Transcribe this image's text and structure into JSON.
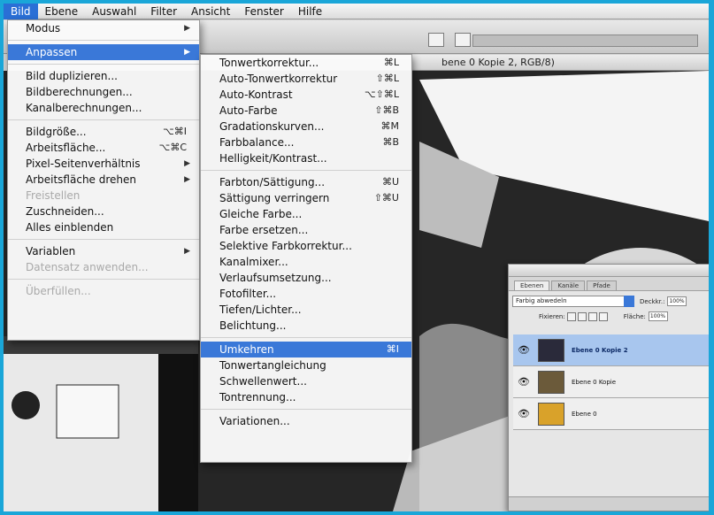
{
  "menubar": [
    "Bild",
    "Ebene",
    "Auswahl",
    "Filter",
    "Ansicht",
    "Fenster",
    "Hilfe"
  ],
  "doc_title": "bene 0 Kopie 2, RGB/8)",
  "bild_menu": [
    {
      "label": "Modus",
      "arrow": true
    },
    {
      "sep": true
    },
    {
      "label": "Anpassen",
      "arrow": true,
      "highlight": true
    },
    {
      "sep": true
    },
    {
      "label": "Bild duplizieren..."
    },
    {
      "label": "Bildberechnungen..."
    },
    {
      "label": "Kanalberechnungen..."
    },
    {
      "sep": true
    },
    {
      "label": "Bildgröße...",
      "shortcut": "⌥⌘I"
    },
    {
      "label": "Arbeitsfläche...",
      "shortcut": "⌥⌘C"
    },
    {
      "label": "Pixel-Seitenverhältnis",
      "arrow": true
    },
    {
      "label": "Arbeitsfläche drehen",
      "arrow": true
    },
    {
      "label": "Freistellen",
      "disabled": true
    },
    {
      "label": "Zuschneiden..."
    },
    {
      "label": "Alles einblenden"
    },
    {
      "sep": true
    },
    {
      "label": "Variablen",
      "arrow": true
    },
    {
      "label": "Datensatz anwenden...",
      "disabled": true
    },
    {
      "sep": true
    },
    {
      "label": "Überfüllen...",
      "disabled": true
    }
  ],
  "anpassen_menu": [
    {
      "label": "Tonwertkorrektur...",
      "shortcut": "⌘L"
    },
    {
      "label": "Auto-Tonwertkorrektur",
      "shortcut": "⇧⌘L"
    },
    {
      "label": "Auto-Kontrast",
      "shortcut": "⌥⇧⌘L"
    },
    {
      "label": "Auto-Farbe",
      "shortcut": "⇧⌘B"
    },
    {
      "label": "Gradationskurven...",
      "shortcut": "⌘M"
    },
    {
      "label": "Farbbalance...",
      "shortcut": "⌘B"
    },
    {
      "label": "Helligkeit/Kontrast..."
    },
    {
      "sep": true
    },
    {
      "label": "Farbton/Sättigung...",
      "shortcut": "⌘U"
    },
    {
      "label": "Sättigung verringern",
      "shortcut": "⇧⌘U"
    },
    {
      "label": "Gleiche Farbe..."
    },
    {
      "label": "Farbe ersetzen..."
    },
    {
      "label": "Selektive Farbkorrektur..."
    },
    {
      "label": "Kanalmixer..."
    },
    {
      "label": "Verlaufsumsetzung..."
    },
    {
      "label": "Fotofilter..."
    },
    {
      "label": "Tiefen/Lichter..."
    },
    {
      "label": "Belichtung..."
    },
    {
      "sep": true
    },
    {
      "label": "Umkehren",
      "shortcut": "⌘I",
      "highlight": true
    },
    {
      "label": "Tonwertangleichung"
    },
    {
      "label": "Schwellenwert..."
    },
    {
      "label": "Tontrennung..."
    },
    {
      "sep": true
    },
    {
      "label": "Variationen..."
    }
  ],
  "layers_panel": {
    "tabs": [
      "Ebenen",
      "Kanäle",
      "Pfade"
    ],
    "blend_mode": "Farbig abwedeln",
    "opacity_label": "Deckkr.:",
    "opacity_value": "100%",
    "lock_label": "Fixieren:",
    "fill_label": "Fläche:",
    "fill_value": "100%",
    "layers": [
      {
        "name": "Ebene 0 Kopie 2",
        "selected": true,
        "thumb": "#2a2a3a"
      },
      {
        "name": "Ebene 0 Kopie",
        "selected": false,
        "thumb": "#6b5a3a"
      },
      {
        "name": "Ebene 0",
        "selected": false,
        "thumb": "#d9a22a"
      }
    ]
  },
  "colors": {
    "frame": "#1aa6d8",
    "highlight": "#3a78d8"
  }
}
